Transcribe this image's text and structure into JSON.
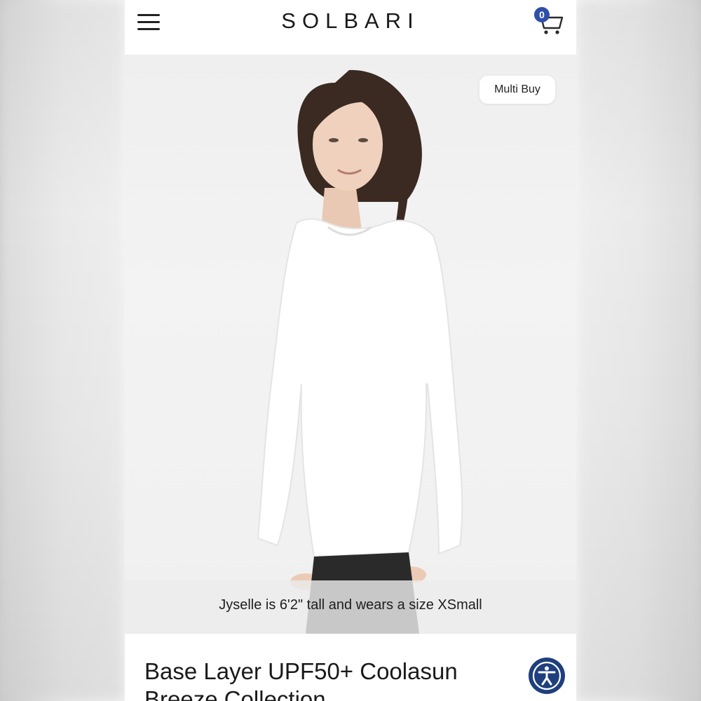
{
  "brand": {
    "logo": "SOLBARI"
  },
  "cart": {
    "count": "0"
  },
  "product": {
    "badge": "Multi Buy",
    "model_caption": "Jyselle is 6'2\" tall and wears a size XSmall",
    "title_line1": "Base Layer UPF50+ Coolasun",
    "title_line2": "Breeze Collection"
  },
  "icons": {
    "menu": "hamburger-menu-icon",
    "cart": "shopping-cart-icon",
    "accessibility": "accessibility-person-icon"
  },
  "colors": {
    "brand_blue": "#2f4fa8",
    "accessibility_blue": "#1f3f7e",
    "text": "#1a1a1a"
  }
}
